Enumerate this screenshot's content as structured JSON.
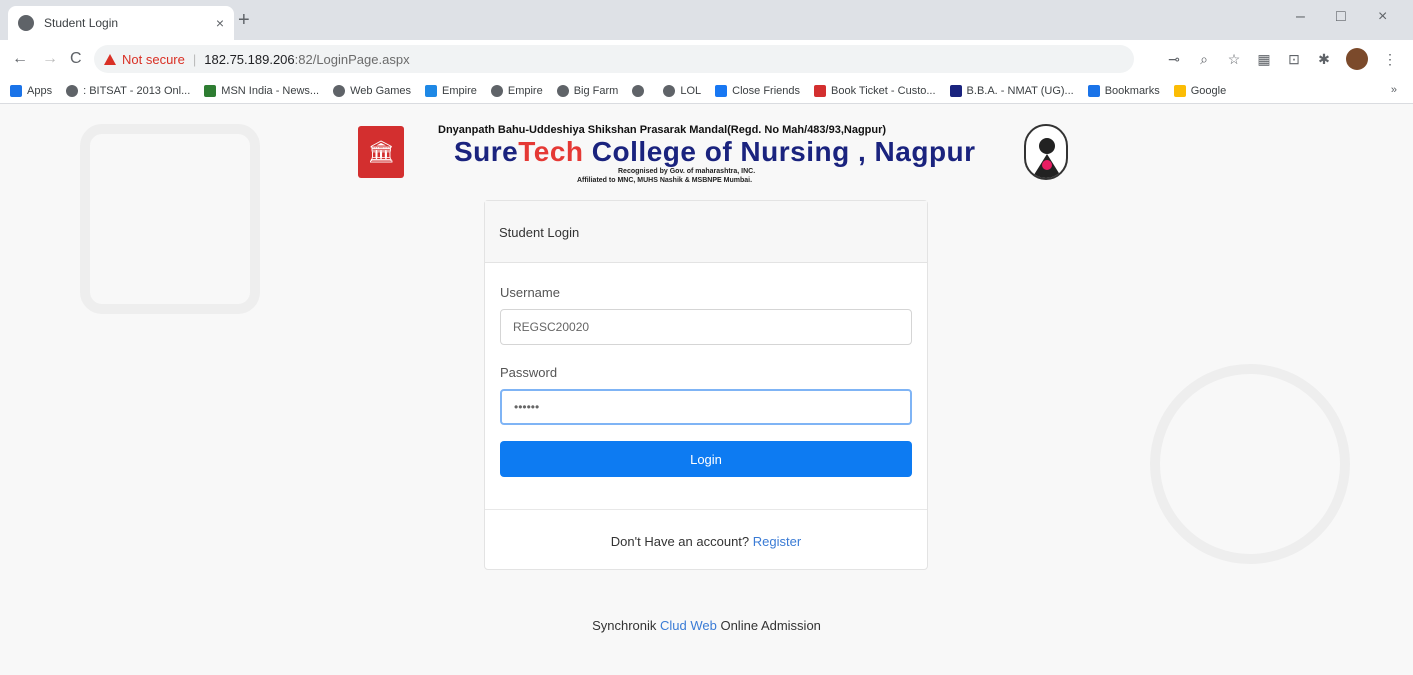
{
  "browser": {
    "tab_title": "Student Login",
    "tab_close": "×",
    "new_tab": "+",
    "not_secure": "Not secure",
    "url_host": "182.75.189.206",
    "url_path": ":82/LoginPage.aspx",
    "window_controls": [
      "–",
      "□",
      "×"
    ],
    "bookmarks": [
      {
        "label": "Apps",
        "color": "#1a73e8"
      },
      {
        "label": ": BITSAT - 2013 Onl...",
        "color": "#5f6368"
      },
      {
        "label": "MSN India - News...",
        "color": "#2e7d32"
      },
      {
        "label": "Web Games",
        "color": "#5f6368"
      },
      {
        "label": "Empire",
        "color": "#1e88e5"
      },
      {
        "label": "Empire",
        "color": "#5f6368"
      },
      {
        "label": "Big Farm",
        "color": "#5f6368"
      },
      {
        "label": "",
        "color": "#5f6368"
      },
      {
        "label": "LOL",
        "color": "#5f6368"
      },
      {
        "label": "Close Friends",
        "color": "#1877f2"
      },
      {
        "label": "Book Ticket - Custo...",
        "color": "#d32f2f"
      },
      {
        "label": "B.B.A. - NMAT (UG)...",
        "color": "#1a237e"
      },
      {
        "label": "Bookmarks",
        "color": "#1a73e8"
      },
      {
        "label": "Google",
        "color": "#fbbc05"
      }
    ]
  },
  "header": {
    "org_line": "Dnyanpath Bahu-Uddeshiya Shikshan Prasarak Mandal(Regd. No Mah/483/93,Nagpur)",
    "college_prefix": "Sure",
    "college_highlight": "Tech",
    "college_rest": " College of Nursing , Nagpur",
    "recognised": "Recognised by Gov. of maharashtra, INC.",
    "affiliated": "Affiliated to MNC, MUHS Nashik & MSBNPE Mumbai."
  },
  "login": {
    "card_title": "Student Login",
    "username_label": "Username",
    "username_value": "REGSC20020",
    "password_label": "Password",
    "password_value": "••••••",
    "login_button": "Login",
    "no_account_text": "Don't Have an account?",
    "register_link": "Register"
  },
  "footer": {
    "brand": "Synchronik",
    "cloud_web": "Clud Web",
    "suffix": "Online Admission"
  }
}
